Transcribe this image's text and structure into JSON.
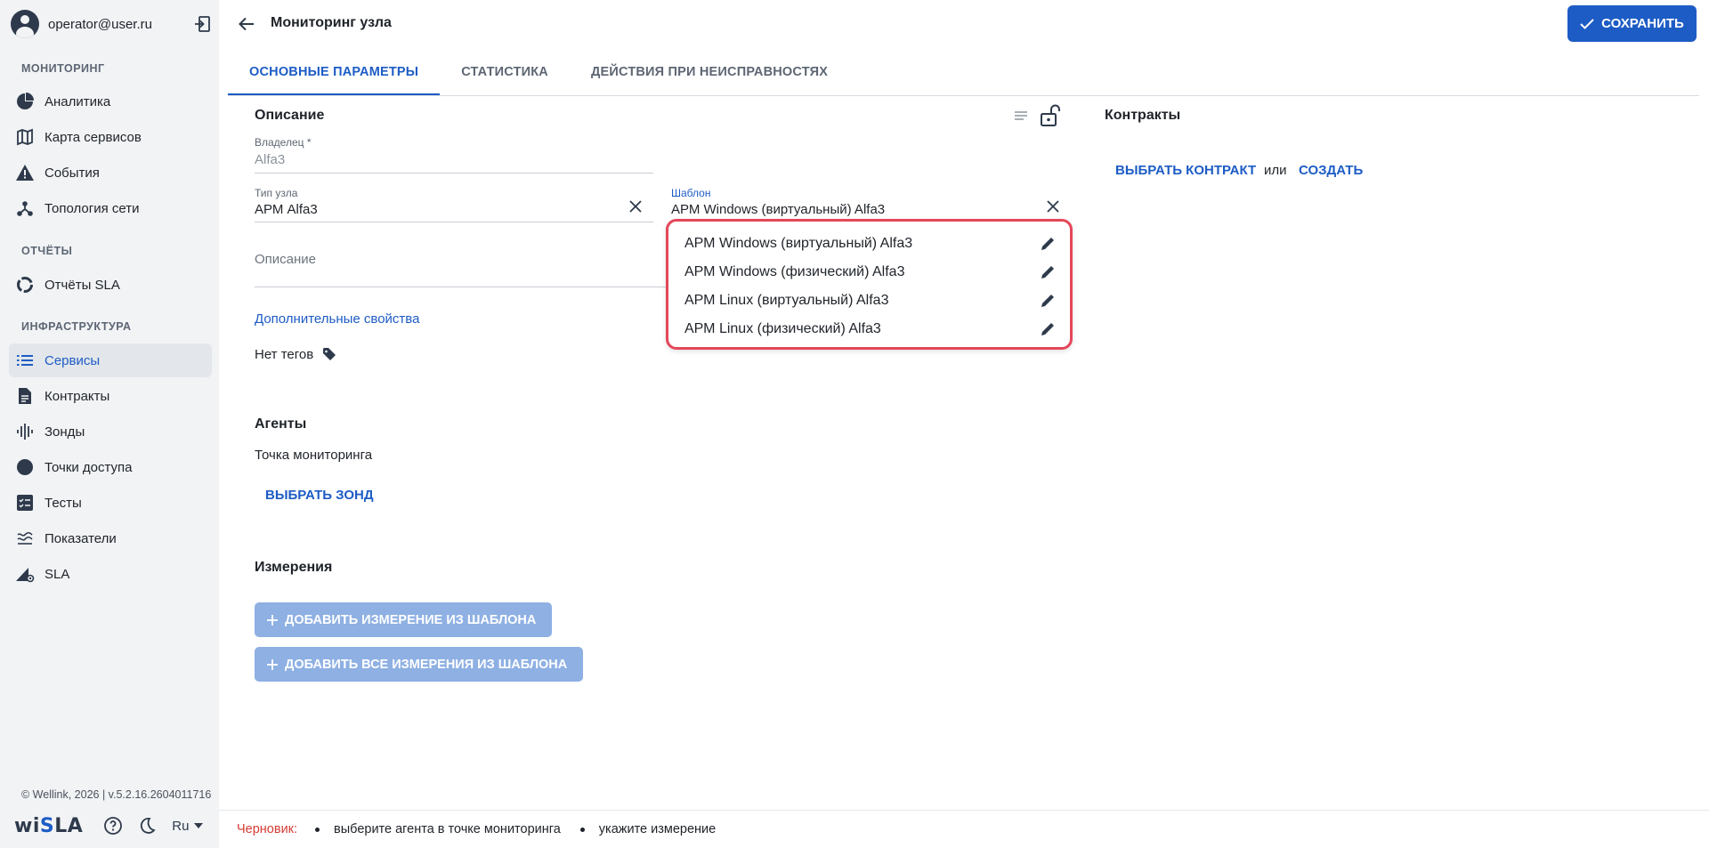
{
  "user": {
    "email": "operator@user.ru"
  },
  "sidebar": {
    "sections": [
      {
        "title": "МОНИТОРИНГ",
        "items": [
          {
            "label": "Аналитика",
            "icon": "pie-chart-icon"
          },
          {
            "label": "Карта сервисов",
            "icon": "map-icon"
          },
          {
            "label": "События",
            "icon": "warning-icon"
          },
          {
            "label": "Топология сети",
            "icon": "topology-icon"
          }
        ]
      },
      {
        "title": "ОТЧЁТЫ",
        "items": [
          {
            "label": "Отчёты SLA",
            "icon": "report-ring-icon"
          }
        ]
      },
      {
        "title": "ИНФРАСТРУКТУРА",
        "items": [
          {
            "label": "Сервисы",
            "icon": "list-icon",
            "active": true
          },
          {
            "label": "Контракты",
            "icon": "document-icon"
          },
          {
            "label": "Зонды",
            "icon": "probe-icon"
          },
          {
            "label": "Точки доступа",
            "icon": "circle-icon"
          },
          {
            "label": "Тесты",
            "icon": "checklist-icon"
          },
          {
            "label": "Показатели",
            "icon": "waves-icon"
          },
          {
            "label": "SLA",
            "icon": "sla-icon"
          }
        ]
      }
    ],
    "version": "© Wellink, 2026 | v.5.2.16.2604011716",
    "logo": {
      "prefix": "wi",
      "highlight": "S",
      "suffix": "LA"
    },
    "language": "Ru"
  },
  "header": {
    "title": "Мониторинг узла",
    "save_label": "СОХРАНИТЬ"
  },
  "tabs": [
    "ОСНОВНЫЕ ПАРАМЕТРЫ",
    "СТАТИСТИКА",
    "ДЕЙСТВИЯ ПРИ НЕИСПРАВНОСТЯХ"
  ],
  "description": {
    "title": "Описание",
    "owner_label": "Владелец *",
    "owner_value": "Alfa3",
    "node_type_label": "Тип узла",
    "node_type_value": "АРМ Alfa3",
    "template_label": "Шаблон",
    "template_value": "АРМ Windows (виртуальный) Alfa3",
    "description_placeholder": "Описание",
    "extra_props_link": "Дополнительные свойства",
    "no_tags": "Нет тегов"
  },
  "template_dropdown": {
    "options": [
      "АРМ Windows (виртуальный) Alfa3",
      "АРМ Windows (физический) Alfa3",
      "АРМ Linux (виртуальный) Alfa3",
      "АРМ Linux (физический) Alfa3"
    ]
  },
  "contracts": {
    "title": "Контракты",
    "choose_label": "ВЫБРАТЬ КОНТРАКТ",
    "or_label": "или",
    "create_label": "СОЗДАТЬ"
  },
  "agents": {
    "title": "Агенты",
    "monitoring_point": "Точка мониторинга",
    "choose_probe": "ВЫБРАТЬ ЗОНД"
  },
  "measurements": {
    "title": "Измерения",
    "add_from_template": "ДОБАВИТЬ ИЗМЕРЕНИЕ ИЗ ШАБЛОНА",
    "add_all_from_template": "ДОБАВИТЬ ВСЕ ИЗМЕРЕНИЯ ИЗ ШАБЛОНА"
  },
  "statusbar": {
    "draft_label": "Черновик:",
    "items": [
      "выберите агента в точке мониторинга",
      "укажите измерение"
    ]
  },
  "colors": {
    "accent": "#1d5cc5",
    "highlight_border": "#e4475a",
    "draft": "#d63c36"
  }
}
